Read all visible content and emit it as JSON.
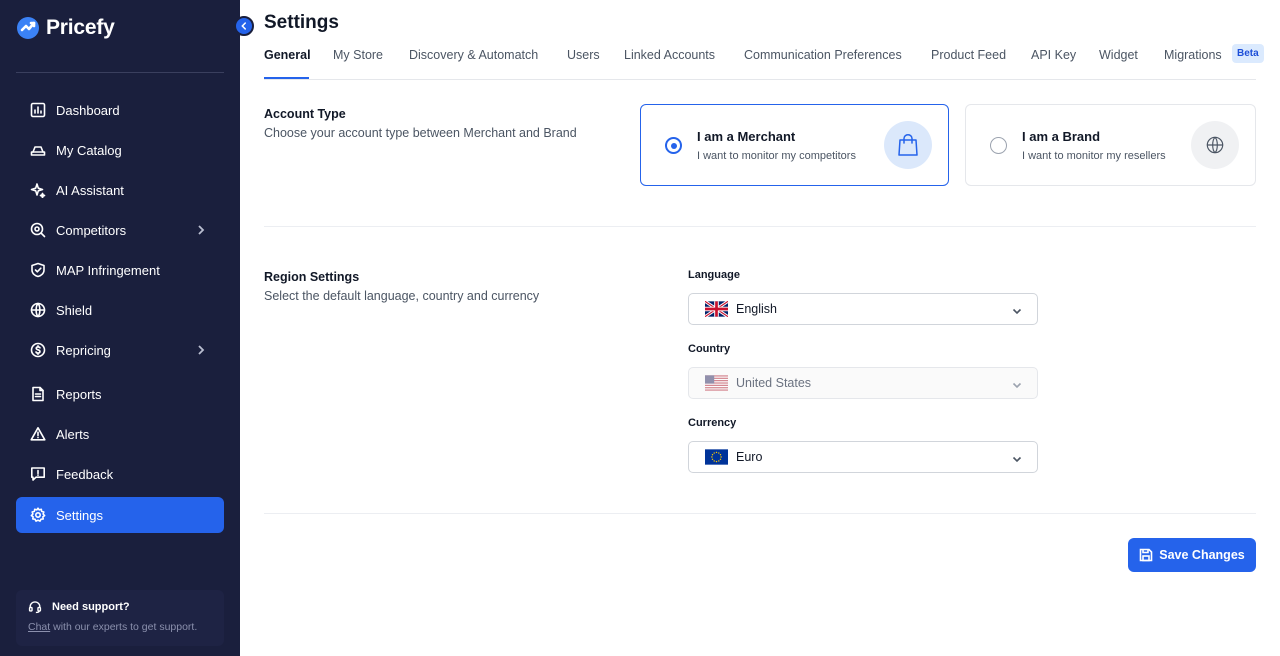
{
  "app": {
    "name": "Pricefy"
  },
  "sidebar": {
    "items": [
      {
        "label": "Dashboard",
        "icon": "dashboard-icon"
      },
      {
        "label": "My Catalog",
        "icon": "catalog-icon"
      },
      {
        "label": "AI Assistant",
        "icon": "sparkle-icon"
      },
      {
        "label": "Competitors",
        "icon": "competitors-icon",
        "has_children": true
      },
      {
        "label": "MAP Infringement",
        "icon": "shield-check-icon"
      },
      {
        "label": "Shield",
        "icon": "globe-icon"
      },
      {
        "label": "Repricing",
        "icon": "repricing-icon",
        "has_children": true
      },
      {
        "label": "Reports",
        "icon": "report-icon"
      },
      {
        "label": "Alerts",
        "icon": "alert-icon"
      },
      {
        "label": "Feedback",
        "icon": "feedback-icon"
      },
      {
        "label": "Settings",
        "icon": "gear-icon",
        "active": true
      }
    ],
    "support": {
      "title": "Need support?",
      "link": "Chat",
      "text": " with our experts to get support."
    }
  },
  "page": {
    "title": "Settings",
    "tabs": [
      {
        "label": "General",
        "active": true
      },
      {
        "label": "My Store"
      },
      {
        "label": "Discovery & Automatch"
      },
      {
        "label": "Users"
      },
      {
        "label": "Linked Accounts"
      },
      {
        "label": "Communication Preferences"
      },
      {
        "label": "Product Feed"
      },
      {
        "label": "API Key"
      },
      {
        "label": "Widget"
      },
      {
        "label": "Migrations"
      }
    ],
    "beta_badge": "Beta"
  },
  "account_type": {
    "title": "Account Type",
    "subtitle": "Choose your account type between Merchant and Brand",
    "options": [
      {
        "title": "I am a Merchant",
        "subtitle": "I want to monitor my competitors",
        "selected": true,
        "icon": "shopping-bag-icon"
      },
      {
        "title": "I am a Brand",
        "subtitle": "I want to monitor my resellers",
        "selected": false,
        "icon": "globe-icon"
      }
    ]
  },
  "region": {
    "title": "Region Settings",
    "subtitle": "Select the default language, country and currency",
    "language": {
      "label": "Language",
      "value": "English",
      "flag": "uk-flag-icon"
    },
    "country": {
      "label": "Country",
      "value": "United States",
      "flag": "us-flag-icon",
      "disabled": true
    },
    "currency": {
      "label": "Currency",
      "value": "Euro",
      "flag": "eu-flag-icon"
    }
  },
  "actions": {
    "save_label": "Save Changes"
  },
  "colors": {
    "sidebar_bg": "#1a1f3d",
    "accent": "#2563eb"
  }
}
